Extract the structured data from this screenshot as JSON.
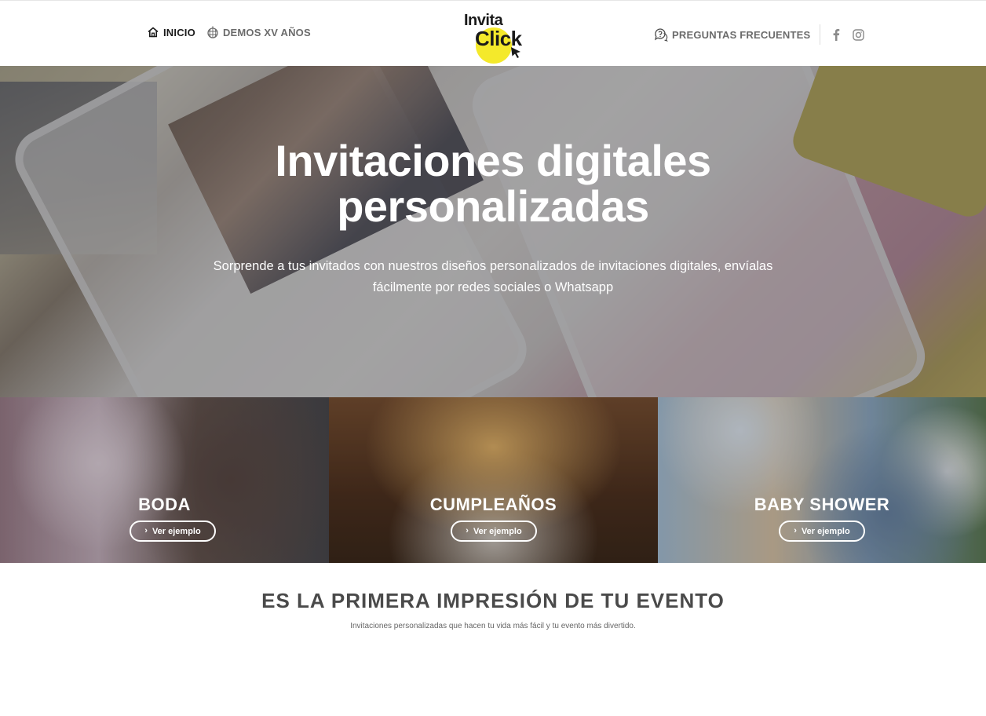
{
  "header": {
    "nav_left": [
      {
        "label": "INICIO",
        "icon": "home-icon",
        "active": true
      },
      {
        "label": "DEMOS XV AÑOS",
        "icon": "disco-ball-icon",
        "active": false
      }
    ],
    "logo": {
      "line1": "Invita",
      "line2": "Click",
      "accent": "#f4e92b"
    },
    "faq_label": "PREGUNTAS FRECUENTES",
    "social": [
      {
        "name": "facebook",
        "icon": "facebook-icon"
      },
      {
        "name": "instagram",
        "icon": "instagram-icon"
      }
    ]
  },
  "hero": {
    "title_line1": "Invitaciones digitales",
    "title_line2": "personalizadas",
    "subtitle_line1": "Sorprende a tus invitados con nuestros diseños personalizados de invitaciones digitales, envíalas",
    "subtitle_line2": "fácilmente por redes sociales o Whatsapp"
  },
  "categories": [
    {
      "title": "BODA",
      "button": "Ver ejemplo"
    },
    {
      "title": "CUMPLEAÑOS",
      "button": "Ver ejemplo"
    },
    {
      "title": "BABY SHOWER",
      "button": "Ver ejemplo"
    }
  ],
  "section": {
    "title": "ES LA PRIMERA IMPRESIÓN DE TU EVENTO",
    "subtitle": "Invitaciones personalizadas que hacen tu vida más fácil y tu evento más divertido."
  },
  "colors": {
    "text_dark": "#1a1a1a",
    "text_muted": "#6b6b6b",
    "heading": "#4a4a4a",
    "logo_yellow": "#f4e92b"
  }
}
